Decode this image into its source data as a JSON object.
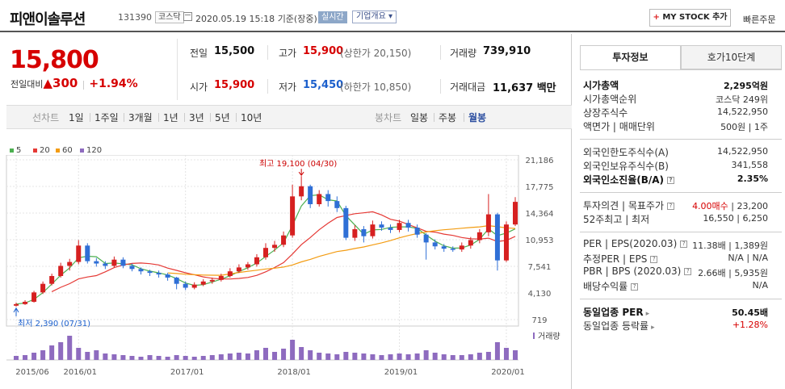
{
  "header": {
    "stock_name": "피앤이솔루션",
    "stock_code": "131390",
    "market_badge": "코스닥",
    "datetime": "2020.05.19 15:18",
    "time_basis": "기준(장중)",
    "realtime_badge": "실시간",
    "company_overview": "기업개요",
    "my_stock_button": "MY STOCK 추가",
    "my_stock_plus": "+",
    "quick_order": "빠른주문"
  },
  "quote": {
    "price": "15,800",
    "change_label": "전일대비",
    "change_arrow": "▲",
    "change": "300",
    "change_pct": "+1.94%",
    "prev_close_label": "전일",
    "prev_close": "15,500",
    "high_label": "고가",
    "high": "15,900",
    "upper_limit_label": "(상한가 20,150)",
    "volume_label": "거래량",
    "volume": "739,910",
    "open_label": "시가",
    "open": "15,900",
    "low_label": "저가",
    "low": "15,450",
    "lower_limit_label": "(하한가 10,850)",
    "amount_label": "거래대금",
    "amount": "11,637",
    "amount_unit": "백만"
  },
  "period_bar": {
    "line_chart_label": "선차트",
    "line_periods": [
      "1일",
      "1주일",
      "3개월",
      "1년",
      "3년",
      "5년",
      "10년"
    ],
    "candle_chart_label": "봉차트",
    "candle_periods": [
      "일봉",
      "주봉",
      "월봉"
    ],
    "selected_candle": "월봉"
  },
  "legend": [
    {
      "label": "5",
      "color": "#4caf50"
    },
    {
      "label": "20",
      "color": "#e53935"
    },
    {
      "label": "60",
      "color": "#f39c12"
    },
    {
      "label": "120",
      "color": "#8e6bbf"
    }
  ],
  "chart_data": {
    "type": "candlestick",
    "y_ticks": [
      "21,186",
      "17,775",
      "14,364",
      "10,953",
      "7,541",
      "4,130",
      "719"
    ],
    "y_tick_values": [
      21186,
      17775,
      14364,
      10953,
      7541,
      4130,
      719
    ],
    "x_ticks": [
      "2015/06",
      "2016/01",
      "2017/01",
      "2018/01",
      "2019/01",
      "2020/01"
    ],
    "x_tick_index": [
      0,
      7,
      19,
      31,
      43,
      55
    ],
    "high_annotation": "최고 19,100 (04/30)",
    "low_annotation": "최저 2,390 (07/31)",
    "volume_label": "거래량",
    "up_color": "#d62020",
    "down_color": "#2f6fd6",
    "candles": [
      [
        2500,
        2700,
        2390,
        2900
      ],
      [
        2700,
        3000,
        2600,
        3200
      ],
      [
        3000,
        4200,
        2900,
        4400
      ],
      [
        4200,
        5300,
        4000,
        5600
      ],
      [
        5300,
        6300,
        5100,
        6600
      ],
      [
        6300,
        7600,
        6100,
        8000
      ],
      [
        7600,
        8100,
        7000,
        8500
      ],
      [
        8100,
        10200,
        7800,
        10900
      ],
      [
        10200,
        8200,
        7900,
        10500
      ],
      [
        8200,
        7900,
        7500,
        8600
      ],
      [
        7900,
        7600,
        7200,
        8200
      ],
      [
        7600,
        8400,
        7400,
        8800
      ],
      [
        8400,
        7600,
        7300,
        8700
      ],
      [
        7600,
        7200,
        6900,
        7900
      ],
      [
        7200,
        6900,
        6500,
        7400
      ],
      [
        6900,
        6700,
        6300,
        7100
      ],
      [
        6700,
        6500,
        6100,
        7000
      ],
      [
        6500,
        6100,
        5700,
        6700
      ],
      [
        6100,
        5300,
        4600,
        6200
      ],
      [
        5300,
        4800,
        4500,
        5600
      ],
      [
        4800,
        5200,
        4600,
        5500
      ],
      [
        5200,
        5600,
        5000,
        5900
      ],
      [
        5600,
        5800,
        5300,
        6100
      ],
      [
        5800,
        6300,
        5600,
        6600
      ],
      [
        6300,
        6900,
        6100,
        7300
      ],
      [
        6900,
        7400,
        6700,
        7800
      ],
      [
        7400,
        7800,
        7100,
        8100
      ],
      [
        7800,
        8700,
        7500,
        9100
      ],
      [
        8700,
        9900,
        8400,
        10500
      ],
      [
        9900,
        10300,
        9400,
        10800
      ],
      [
        10300,
        11500,
        10000,
        12000
      ],
      [
        11500,
        16500,
        11200,
        18000
      ],
      [
        16500,
        17800,
        16000,
        19100
      ],
      [
        17800,
        15500,
        15000,
        18000
      ],
      [
        15500,
        16800,
        15200,
        17300
      ],
      [
        16800,
        15900,
        15200,
        17300
      ],
      [
        15900,
        15000,
        14500,
        16500
      ],
      [
        15000,
        11200,
        10900,
        15300
      ],
      [
        11200,
        12300,
        10800,
        12800
      ],
      [
        12300,
        11400,
        10600,
        12700
      ],
      [
        11400,
        12900,
        11100,
        13400
      ],
      [
        12900,
        12500,
        12100,
        13300
      ],
      [
        12500,
        12200,
        11800,
        12900
      ],
      [
        12200,
        13100,
        11900,
        13500
      ],
      [
        13100,
        12500,
        12000,
        13500
      ],
      [
        12500,
        11600,
        11200,
        12900
      ],
      [
        11600,
        10600,
        8400,
        11800
      ],
      [
        10600,
        10100,
        9700,
        11000
      ],
      [
        10100,
        9800,
        9400,
        10400
      ],
      [
        9800,
        9700,
        9400,
        10100
      ],
      [
        9700,
        10200,
        9400,
        10600
      ],
      [
        10200,
        10900,
        9800,
        11300
      ],
      [
        10900,
        11900,
        10500,
        12300
      ],
      [
        11900,
        14200,
        11400,
        16800
      ],
      [
        14200,
        8300,
        7000,
        14400
      ],
      [
        8300,
        12900,
        8100,
        13300
      ],
      [
        12900,
        15800,
        12700,
        16400
      ]
    ],
    "volumes": [
      5,
      6,
      9,
      12,
      18,
      22,
      30,
      15,
      10,
      12,
      8,
      7,
      6,
      5,
      4,
      6,
      5,
      4,
      6,
      5,
      4,
      5,
      6,
      7,
      8,
      9,
      8,
      12,
      15,
      10,
      14,
      25,
      16,
      12,
      9,
      8,
      7,
      10,
      9,
      8,
      7,
      6,
      7,
      8,
      7,
      8,
      12,
      9,
      7,
      6,
      6,
      7,
      9,
      10,
      22,
      15,
      12
    ],
    "ma_colors": {
      "ma5": "#4caf50",
      "ma20": "#e53935",
      "ma60": "#f39c12"
    }
  },
  "right_panel": {
    "tab_invest": "투자정보",
    "tab_orderbook": "호가10단계",
    "group1": [
      {
        "label": "시가총액",
        "value": "2,295억원",
        "bold": true
      },
      {
        "label": "시가총액순위",
        "value": "코스닥 249위"
      },
      {
        "label": "상장주식수",
        "value": "14,522,950"
      },
      {
        "label": "액면가 | 매매단위",
        "value": "500원 | 1주"
      }
    ],
    "group2": [
      {
        "label": "외국인한도주식수(A)",
        "value": "14,522,950"
      },
      {
        "label": "외국인보유주식수(B)",
        "value": "341,558"
      },
      {
        "label": "외국인소진율(B/A)",
        "value": "2.35%",
        "bold": true
      }
    ],
    "group3": [
      {
        "label": "투자의견 | 목표주가",
        "value_red": "4.00매수",
        "value": "23,200"
      },
      {
        "label": "52주최고 | 최저",
        "value": "16,550 | 6,250"
      }
    ],
    "group4": [
      {
        "label": "PER | EPS(2020.03)",
        "value": "11.38배 | 1,389원"
      },
      {
        "label": "추정PER | EPS",
        "value": "N/A | N/A"
      },
      {
        "label": "PBR | BPS (2020.03)",
        "value": "2.66배 | 5,935원"
      },
      {
        "label": "배당수익률",
        "value": "N/A"
      }
    ],
    "group5": [
      {
        "label": "동일업종 PER",
        "value": "50.45배",
        "bold": true
      },
      {
        "label": "동일업종 등락률",
        "value": "+1.28%",
        "red": true
      }
    ],
    "info_icon_glyph": "?"
  }
}
